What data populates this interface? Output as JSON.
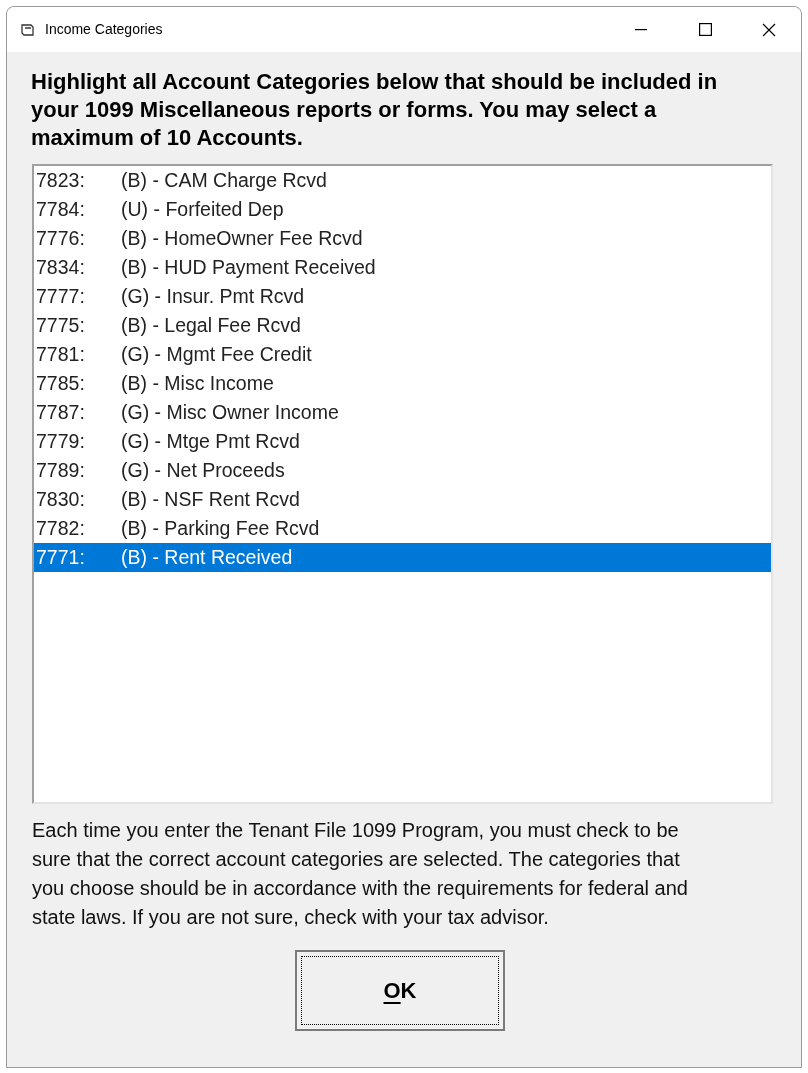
{
  "window": {
    "title": "Income Categories"
  },
  "instructions": "Highlight all Account Categories below that should be included in your 1099 Miscellaneous reports or forms. You may select a maximum of 10 Accounts.",
  "accounts": [
    {
      "code": "7823:",
      "name": "(B) - CAM Charge Rcvd",
      "selected": false
    },
    {
      "code": "7784:",
      "name": "(U) - Forfeited Dep",
      "selected": false
    },
    {
      "code": "7776:",
      "name": "(B) - HomeOwner Fee Rcvd",
      "selected": false
    },
    {
      "code": "7834:",
      "name": "(B) - HUD Payment Received",
      "selected": false
    },
    {
      "code": "7777:",
      "name": "(G) - Insur. Pmt Rcvd",
      "selected": false
    },
    {
      "code": "7775:",
      "name": "(B) - Legal Fee Rcvd",
      "selected": false
    },
    {
      "code": "7781:",
      "name": "(G) - Mgmt Fee Credit",
      "selected": false
    },
    {
      "code": "7785:",
      "name": "(B) - Misc Income",
      "selected": false
    },
    {
      "code": "7787:",
      "name": "(G) - Misc Owner Income",
      "selected": false
    },
    {
      "code": "7779:",
      "name": "(G) - Mtge Pmt Rcvd",
      "selected": false
    },
    {
      "code": "7789:",
      "name": "(G) - Net Proceeds",
      "selected": false
    },
    {
      "code": "7830:",
      "name": "(B) - NSF Rent Rcvd",
      "selected": false
    },
    {
      "code": "7782:",
      "name": "(B) - Parking Fee Rcvd",
      "selected": false
    },
    {
      "code": "7771:",
      "name": "(B) - Rent Received",
      "selected": true
    }
  ],
  "note": "Each time you enter the Tenant File 1099 Program, you must check to be sure that the correct account categories are selected. The categories that you choose should be in accordance with the requirements for federal and state laws. If you are not sure, check with your tax advisor.",
  "ok_button": {
    "label_parts": [
      {
        "text": "O",
        "underlined": true
      },
      {
        "text": "K",
        "underlined": false
      }
    ]
  }
}
